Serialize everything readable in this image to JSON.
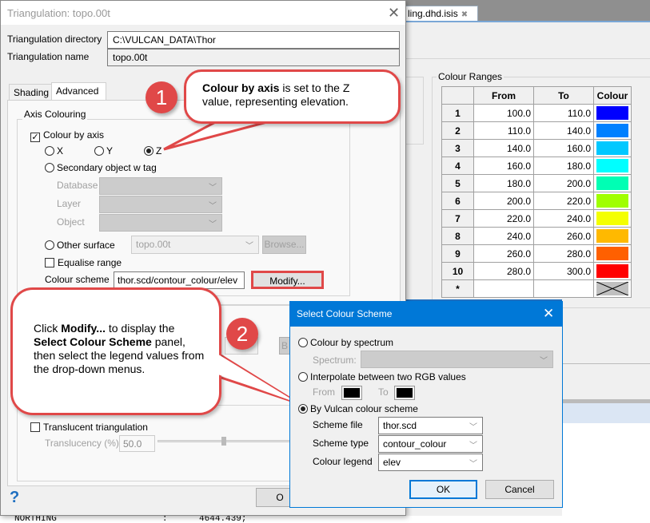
{
  "background": {
    "doc_tab": "ling.dhd.isis",
    "doc_tab_close": "✖",
    "colour_ranges": {
      "label": "Colour Ranges",
      "headers": [
        "",
        "From",
        "To",
        "Colour"
      ],
      "rows": [
        {
          "n": "1",
          "from": "100.0",
          "to": "110.0",
          "colour": "#0000ff"
        },
        {
          "n": "2",
          "from": "110.0",
          "to": "140.0",
          "colour": "#0080ff"
        },
        {
          "n": "3",
          "from": "140.0",
          "to": "160.0",
          "colour": "#00c8ff"
        },
        {
          "n": "4",
          "from": "160.0",
          "to": "180.0",
          "colour": "#00ffff"
        },
        {
          "n": "5",
          "from": "180.0",
          "to": "200.0",
          "colour": "#00ffb4"
        },
        {
          "n": "6",
          "from": "200.0",
          "to": "220.0",
          "colour": "#a0ff00"
        },
        {
          "n": "7",
          "from": "220.0",
          "to": "240.0",
          "colour": "#f4ff00"
        },
        {
          "n": "8",
          "from": "240.0",
          "to": "260.0",
          "colour": "#ffb900"
        },
        {
          "n": "9",
          "from": "260.0",
          "to": "280.0",
          "colour": "#ff6000"
        },
        {
          "n": "10",
          "from": "280.0",
          "to": "300.0",
          "colour": "#ff0000"
        }
      ],
      "new_row": "*"
    },
    "console_line": "NORTHING                    :      4644.439;"
  },
  "dialog": {
    "title": "Triangulation: topo.00t",
    "dir_label": "Triangulation directory",
    "dir_value": "C:\\VULCAN_DATA\\Thor",
    "name_label": "Triangulation name",
    "name_value": "topo.00t",
    "tabs": [
      "Shading",
      "Advanced"
    ],
    "active_tab": "Advanced",
    "axis_group": "Axis Colouring",
    "colour_by_axis": "Colour by axis",
    "colour_by_axis_checked": true,
    "axes": [
      "X",
      "Y",
      "Z"
    ],
    "selected_axis": "Z",
    "secondary": "Secondary object w tag",
    "database": "Database",
    "layer": "Layer",
    "object": "Object",
    "other_surface": "Other surface",
    "other_surface_value": "topo.00t",
    "browse": "Browse...",
    "browse2": "B",
    "equalise": "Equalise range",
    "scheme_label": "Colour scheme",
    "scheme_value": "thor.scd/contour_colour/elev",
    "modify": "Modify...",
    "translucent": "Translucent triangulation",
    "translucency_label": "Translucency (%)",
    "translucency_value": "50.0",
    "help": "?",
    "ok_partial": "O"
  },
  "callouts": {
    "one": {
      "badge": "1",
      "bold": "Colour by axis",
      "text": " is set to the Z value, representing elevation."
    },
    "two": {
      "badge": "2",
      "p1": "Click ",
      "b1": "Modify...",
      "p2": "  to display the ",
      "b2": "Select Colour Scheme",
      "p3": " panel, then select the legend values from the drop-down menus."
    }
  },
  "scheme_dialog": {
    "title": "Select Colour Scheme",
    "spectrum_opt": "Colour by spectrum",
    "spectrum_label": "Spectrum:",
    "interp_opt": "Interpolate between two RGB values",
    "from": "From",
    "to": "To",
    "from_colour": "#000000",
    "to_colour": "#000000",
    "vulcan_opt": "By Vulcan colour scheme",
    "selected": "By Vulcan colour scheme",
    "file_label": "Scheme file",
    "file_value": "thor.scd",
    "type_label": "Scheme type",
    "type_value": "contour_colour",
    "legend_label": "Colour legend",
    "legend_value": "elev",
    "ok": "OK",
    "cancel": "Cancel"
  }
}
